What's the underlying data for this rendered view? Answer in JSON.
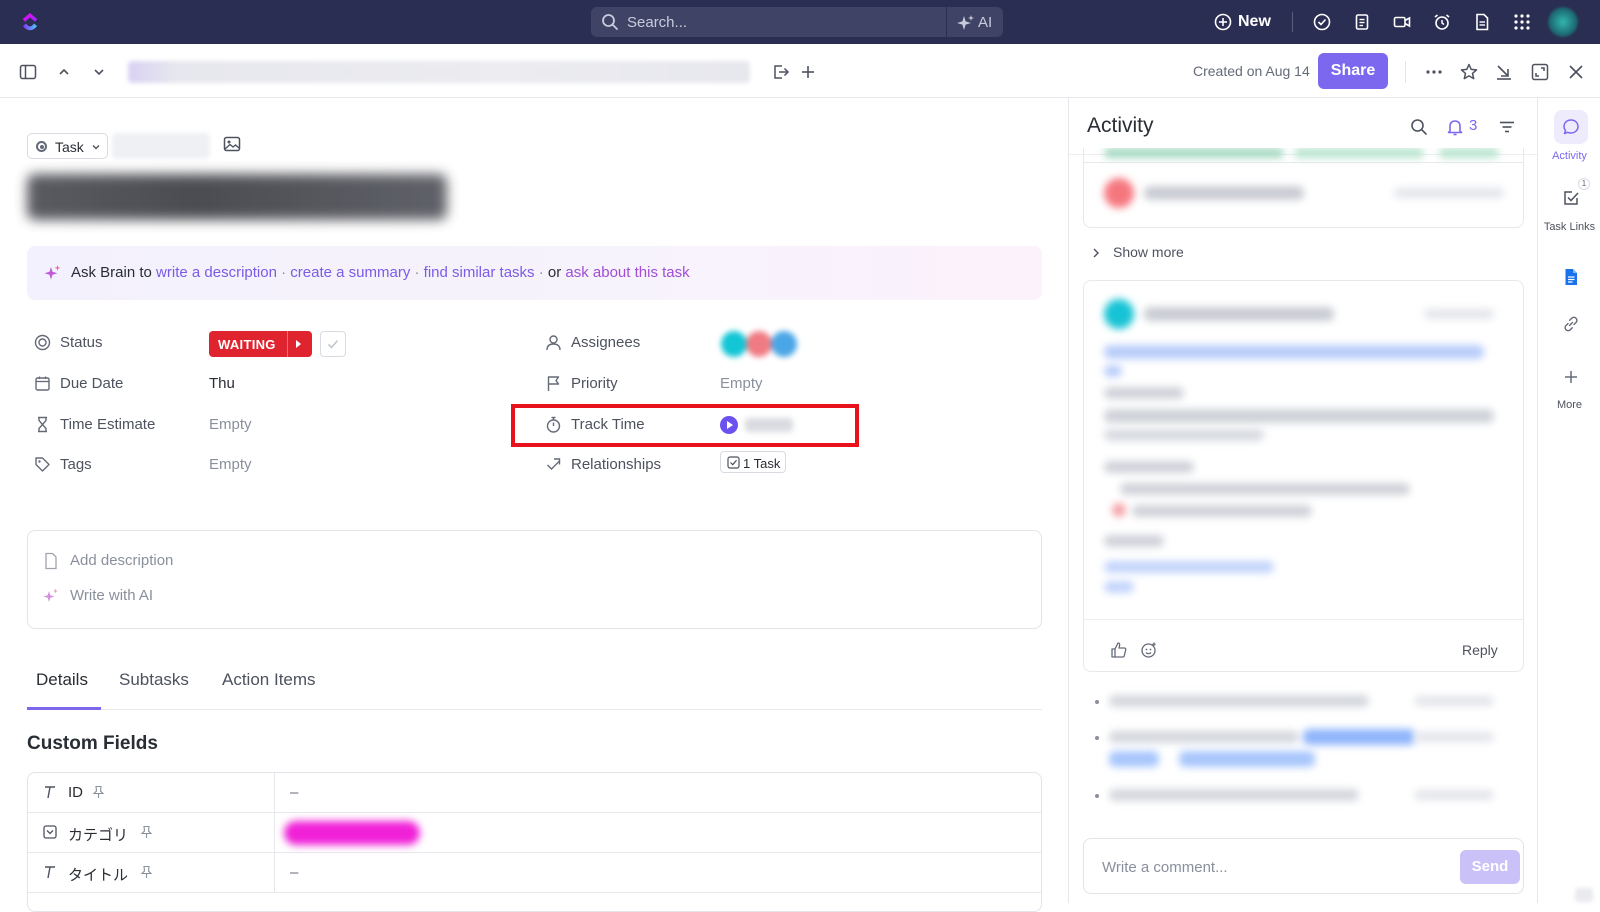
{
  "topbar": {
    "search_placeholder": "Search...",
    "ai_label": "AI",
    "new_label": "New"
  },
  "header": {
    "created_text": "Created on Aug 14",
    "share_label": "Share"
  },
  "task": {
    "type_label": "Task",
    "brain": {
      "prefix": "Ask Brain to",
      "link1": "write a description",
      "link2": "create a summary",
      "link3": "find similar tasks",
      "or": "or",
      "link4": "ask about this task"
    },
    "fields": {
      "status_label": "Status",
      "status_value": "WAITING",
      "due_label": "Due Date",
      "due_value": "Thu",
      "estimate_label": "Time Estimate",
      "estimate_value": "Empty",
      "tags_label": "Tags",
      "tags_value": "Empty",
      "assignees_label": "Assignees",
      "priority_label": "Priority",
      "priority_value": "Empty",
      "track_label": "Track Time",
      "relationships_label": "Relationships",
      "relationships_value": "1 Task"
    },
    "description": {
      "add": "Add description",
      "ai": "Write with AI"
    },
    "tabs": [
      "Details",
      "Subtasks",
      "Action Items"
    ],
    "custom_fields": {
      "heading": "Custom Fields",
      "rows": [
        {
          "name": "ID",
          "value": "–"
        },
        {
          "name": "カテゴリ",
          "value": ""
        },
        {
          "name": "タイトル",
          "value": "–"
        }
      ]
    }
  },
  "activity": {
    "title": "Activity",
    "bell_count": "3",
    "show_more": "Show more",
    "reply": "Reply",
    "comment_placeholder": "Write a comment...",
    "send": "Send"
  },
  "rail": {
    "activity": "Activity",
    "task_links": "Task Links",
    "task_links_badge": "1",
    "more": "More"
  },
  "colors": {
    "accent": "#7b68ee",
    "topbar": "#2a2e52",
    "status_waiting": "#e0242f",
    "highlight_box": "#e8121d"
  }
}
